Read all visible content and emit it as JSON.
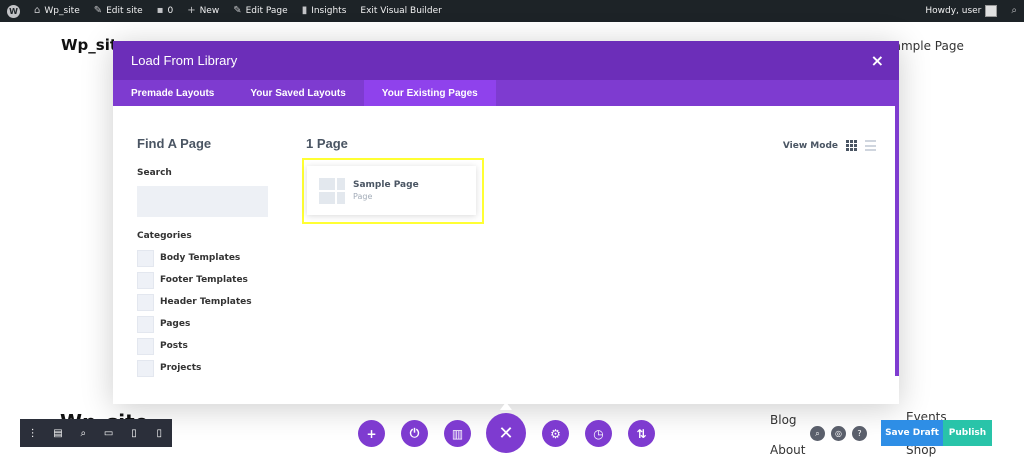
{
  "adminbar": {
    "site": "Wp_site",
    "edit_site": "Edit site",
    "comments": "0",
    "new": "New",
    "edit_page": "Edit Page",
    "insights": "Insights",
    "exit_vb": "Exit Visual Builder",
    "howdy": "Howdy, user"
  },
  "site": {
    "title": "Wp_site",
    "nav_sample": "Sample Page",
    "bg_big_title": "Wp_site",
    "links": [
      "Blog",
      "About",
      "Events",
      "Shop"
    ]
  },
  "modal": {
    "title": "Load From Library",
    "close": "×",
    "tabs": [
      {
        "label": "Premade Layouts"
      },
      {
        "label": "Your Saved Layouts"
      },
      {
        "label": "Your Existing Pages"
      }
    ],
    "sidebar": {
      "find_title": "Find A Page",
      "search_label": "Search",
      "search_value": "",
      "categories_label": "Categories",
      "categories": [
        {
          "label": "Body Templates"
        },
        {
          "label": "Footer Templates"
        },
        {
          "label": "Header Templates"
        },
        {
          "label": "Pages"
        },
        {
          "label": "Posts"
        },
        {
          "label": "Projects"
        }
      ]
    },
    "content": {
      "page_count": "1 Page",
      "view_mode": "View Mode",
      "card": {
        "title": "Sample Page",
        "subtitle": "Page"
      }
    }
  },
  "bottom": {
    "save_draft": "Save Draft",
    "publish": "Publish"
  },
  "colors": {
    "modal_header": "#6c2eb9",
    "tabs_bar": "#7e3bd0",
    "active_tab": "#8f42ec",
    "highlight": "#ffff33",
    "save_draft": "#2e8ee6",
    "publish": "#29c4a9"
  }
}
